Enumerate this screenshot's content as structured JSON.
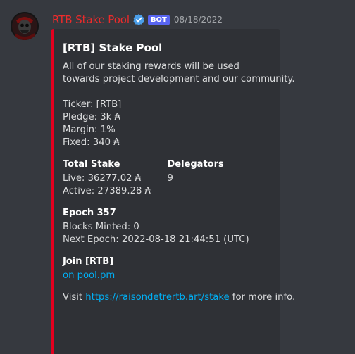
{
  "message": {
    "author": "RTB Stake Pool",
    "bot_tag": "BOT",
    "timestamp": "08/18/2022"
  },
  "embed": {
    "accent_color": "#e4001f",
    "title": "[RTB] Stake Pool",
    "description_lines": [
      "All of our staking rewards will be used",
      "towards project development and our community."
    ],
    "pool_info": {
      "ticker": "Ticker: [RTB]",
      "pledge": "Pledge: 3k ₳",
      "margin": "Margin: 1%",
      "fixed": "Fixed: 340 ₳"
    },
    "total_stake": {
      "name": "Total Stake",
      "live": "Live: 36277.02 ₳",
      "active": "Active: 27389.28 ₳"
    },
    "delegators": {
      "name": "Delegators",
      "value": "9"
    },
    "epoch": {
      "name": "Epoch 357",
      "blocks_minted": "Blocks Minted: 0",
      "next_epoch": "Next Epoch: 2022-08-18 21:44:51 (UTC)"
    },
    "join": {
      "name": "Join [RTB]",
      "link_text": "on pool.pm"
    },
    "footer": {
      "prefix": "Visit ",
      "link_text": "https://raisondetrertb.art/stake",
      "suffix": " for more info."
    }
  },
  "icons": {
    "avatar": "skull-avatar-icon",
    "verified": "verified-badge-icon"
  }
}
